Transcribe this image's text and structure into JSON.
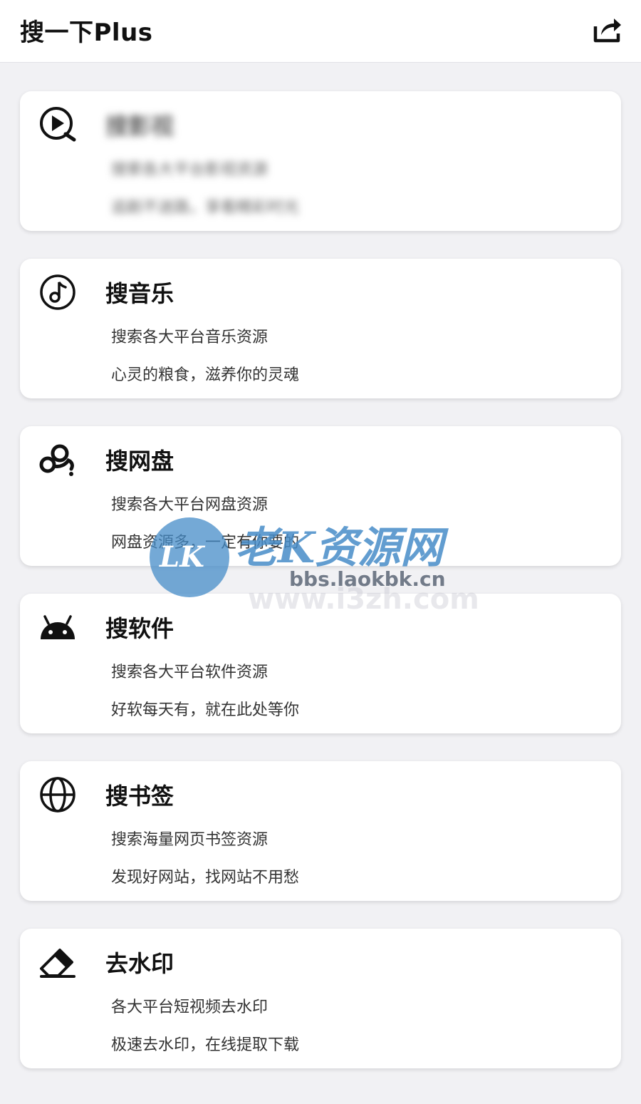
{
  "header": {
    "title": "搜一下Plus",
    "share_icon": "share-icon"
  },
  "cards": [
    {
      "icon": "play-search-icon",
      "title": "搜影视",
      "description": "搜索各大平台影视资源",
      "slogan": "追剧不迷路，享看精彩时光",
      "blurred": true
    },
    {
      "icon": "music-note-icon",
      "title": "搜音乐",
      "description": "搜索各大平台音乐资源",
      "slogan": "心灵的粮食，滋养你的灵魂"
    },
    {
      "icon": "cloud-drive-icon",
      "title": "搜网盘",
      "description": "搜索各大平台网盘资源",
      "slogan": "网盘资源多，一定有你要的"
    },
    {
      "icon": "android-icon",
      "title": "搜软件",
      "description": "搜索各大平台软件资源",
      "slogan": "好软每天有，就在此处等你"
    },
    {
      "icon": "globe-icon",
      "title": "搜书签",
      "description": "搜索海量网页书签资源",
      "slogan": "发现好网站，找网站不用愁"
    },
    {
      "icon": "eraser-icon",
      "title": "去水印",
      "description": "各大平台短视频去水印",
      "slogan": "极速去水印，在线提取下载"
    }
  ],
  "watermark": {
    "logo_text": "LK",
    "name": "老K资源网",
    "url": "bbs.laokbk.cn",
    "url_faint": "www.i3zh.com"
  },
  "colors": {
    "background": "#f1f1f4",
    "card": "#ffffff",
    "text": "#111111",
    "watermark_blue": "#468cc8"
  }
}
